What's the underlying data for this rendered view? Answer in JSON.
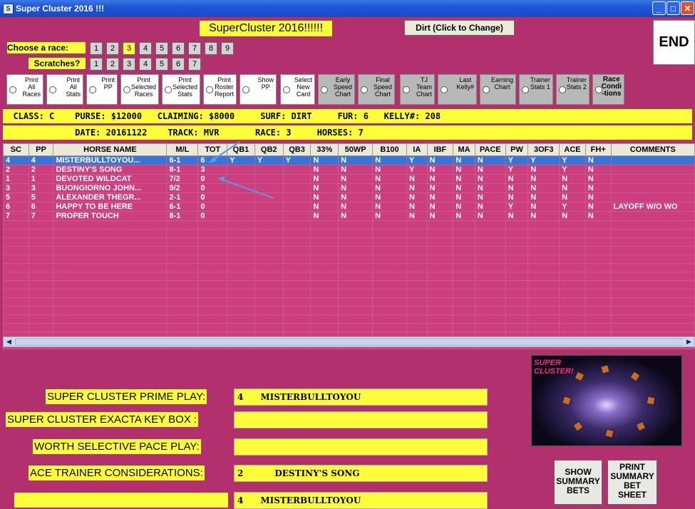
{
  "window": {
    "title": "Super Cluster 2016 !!!",
    "minimize": "_",
    "maximize": "□",
    "close": "✕"
  },
  "header": {
    "title": "SuperCluster  2016!!!!!!",
    "surface_button": "Dirt (Click to Change)",
    "end_button": "END"
  },
  "choose_race": {
    "label": "Choose  a race:",
    "races": [
      "1",
      "2",
      "3",
      "4",
      "5",
      "6",
      "7",
      "8",
      "9"
    ],
    "selected": "3"
  },
  "scratches": {
    "label": "Scratches?",
    "items": [
      "1",
      "2",
      "3",
      "4",
      "5",
      "6",
      "7"
    ]
  },
  "options": [
    {
      "label": "Print\nAll\nRaces"
    },
    {
      "label": "Print\nAll\nStats"
    },
    {
      "label": "Print\nPP"
    },
    {
      "label": "Print\nSelected\nRaces"
    },
    {
      "label": "Print\nSelected\nStats"
    },
    {
      "label": "Print\nRoster\nReport"
    },
    {
      "label": "Show\nPP"
    },
    {
      "label": "Select\nNew\nCard"
    },
    {
      "label": "Early\nSpeed\nChart"
    },
    {
      "label": "Final\nSpeed\nChart"
    },
    {
      "label": "TJ\nTeam\nChart"
    },
    {
      "label": "Last\nKelly#"
    },
    {
      "label": "Earning\nChart"
    },
    {
      "label": "Trainer\nStats 1"
    },
    {
      "label": "Trainer\nStats 2"
    },
    {
      "label": "Race\nCondi\n-tions"
    }
  ],
  "race_info": {
    "line1": "  CLASS: C    PURSE: $12000   CLAIMING: $8000     SURF: DIRT     FUR: 6   KELLY#: 208",
    "line2": "              DATE: 20161122    TRACK: MVR       RACE: 3     HORSES: 7"
  },
  "table": {
    "columns": [
      "SC",
      "PP",
      "HORSE NAME",
      "M/L",
      "TOT",
      "QB1",
      "QB2",
      "QB3",
      "33%",
      "50WP",
      "B100",
      "IA",
      "IBF",
      "MA",
      "PACE",
      "PW",
      "3OF3",
      "ACE",
      "FH+",
      "COMMENTS"
    ],
    "rows": [
      [
        "4",
        "4",
        "MISTERBULLTOYOU...",
        "6-1",
        "6",
        "Y",
        "Y",
        "Y",
        "N",
        "N",
        "N",
        "Y",
        "N",
        "N",
        "N",
        "Y",
        "Y",
        "Y",
        "N",
        ""
      ],
      [
        "2",
        "2",
        "DESTINY'S SONG",
        "8-1",
        "3",
        "",
        "",
        "",
        "N",
        "N",
        "N",
        "Y",
        "N",
        "N",
        "N",
        "Y",
        "N",
        "Y",
        "N",
        ""
      ],
      [
        "1",
        "1",
        "DEVOTED WILDCAT",
        "7/2",
        "0",
        "",
        "",
        "",
        "N",
        "N",
        "N",
        "N",
        "N",
        "N",
        "N",
        "N",
        "N",
        "N",
        "N",
        ""
      ],
      [
        "3",
        "3",
        "BUONGIORNO JOHN...",
        "9/2",
        "0",
        "",
        "",
        "",
        "N",
        "N",
        "N",
        "N",
        "N",
        "N",
        "N",
        "N",
        "N",
        "N",
        "N",
        ""
      ],
      [
        "5",
        "5",
        "ALEXANDER THEGR...",
        "2-1",
        "0",
        "",
        "",
        "",
        "N",
        "N",
        "N",
        "N",
        "N",
        "N",
        "N",
        "N",
        "N",
        "N",
        "N",
        ""
      ],
      [
        "6",
        "6",
        "HAPPY TO BE HERE",
        "6-1",
        "0",
        "",
        "",
        "",
        "N",
        "N",
        "N",
        "N",
        "N",
        "N",
        "N",
        "Y",
        "N",
        "Y",
        "N",
        "LAYOFF W/O WO"
      ],
      [
        "7",
        "7",
        "PROPER TOUCH",
        "8-1",
        "0",
        "",
        "",
        "",
        "N",
        "N",
        "N",
        "N",
        "N",
        "N",
        "N",
        "N",
        "N",
        "N",
        "N",
        ""
      ]
    ],
    "empty_rows": 15
  },
  "plays": [
    {
      "label": "SUPER CLUSTER PRIME PLAY:",
      "pp": "4",
      "horse": "MISTERBULLTOYOU"
    },
    {
      "label": "SUPER CLUSTER  EXACTA KEY BOX :",
      "pp": "",
      "horse": ""
    },
    {
      "label": "WORTH SELECTIVE PACE PLAY:",
      "pp": "",
      "horse": ""
    },
    {
      "label": "ACE TRAINER CONSIDERATIONS:",
      "pp": "2",
      "horse": "DESTINY'S SONG"
    },
    {
      "label": "",
      "pp": "4",
      "horse": "MISTERBULLTOYOU"
    }
  ],
  "logo_text": "SUPER\nCLUSTER!",
  "summary": {
    "show": "SHOW\nSUMMARY\nBETS",
    "print": "PRINT\nSUMMARY\nBET\nSHEET"
  }
}
